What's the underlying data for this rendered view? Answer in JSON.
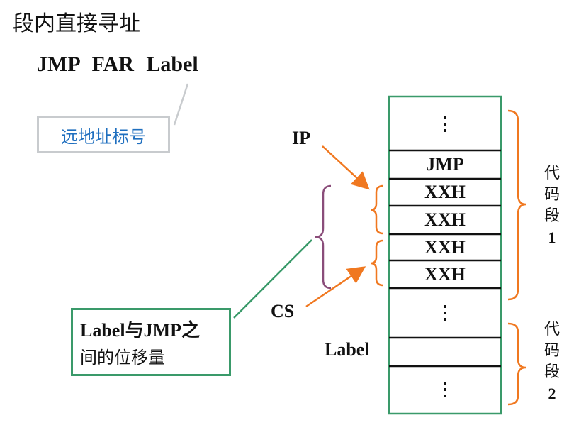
{
  "title": "段内直接寻址",
  "instruction": "JMP  FAR  Label",
  "far_label_box": "远地址标号",
  "offset_box": {
    "line1": "Label与JMP之",
    "line2": "间的位移量"
  },
  "pointers": {
    "ip": "IP",
    "cs": "CS",
    "label": "Label"
  },
  "memory_cells": [
    "⋮",
    "JMP",
    "XXH",
    "XXH",
    "XXH",
    "XXH",
    "⋮",
    "",
    "⋮"
  ],
  "segments": [
    {
      "chars": [
        "代",
        "码",
        "段"
      ],
      "num": "1"
    },
    {
      "chars": [
        "代",
        "码",
        "段"
      ],
      "num": "2"
    }
  ],
  "colors": {
    "orange": "#f07820",
    "green": "#3a9a6a",
    "purple": "#8a4d7a",
    "gray": "#c8cbce",
    "blue": "#1f6fbf"
  }
}
